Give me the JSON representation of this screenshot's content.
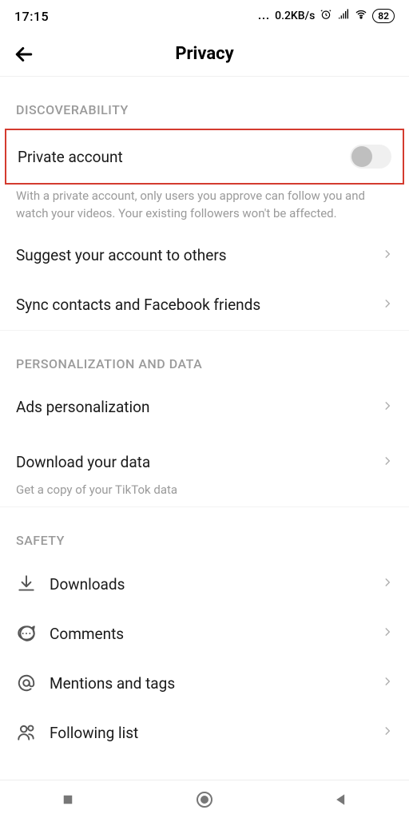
{
  "status_bar": {
    "time": "17:15",
    "net_speed": "0.2KB/s",
    "battery": "82"
  },
  "header": {
    "title": "Privacy"
  },
  "sections": {
    "discoverability": {
      "header": "DISCOVERABILITY",
      "private_account": {
        "label": "Private account",
        "description": "With a private account, only users you approve can follow you and watch your videos. Your existing followers won't be affected.",
        "toggle_on": false
      },
      "suggest": {
        "label": "Suggest your account to others"
      },
      "sync": {
        "label": "Sync contacts and Facebook friends"
      }
    },
    "personalization": {
      "header": "PERSONALIZATION AND DATA",
      "ads": {
        "label": "Ads personalization"
      },
      "download_data": {
        "label": "Download your data",
        "subtext": "Get a copy of your TikTok data"
      }
    },
    "safety": {
      "header": "SAFETY",
      "downloads": {
        "label": "Downloads"
      },
      "comments": {
        "label": "Comments"
      },
      "mentions": {
        "label": "Mentions and tags"
      },
      "following": {
        "label": "Following list"
      }
    }
  }
}
